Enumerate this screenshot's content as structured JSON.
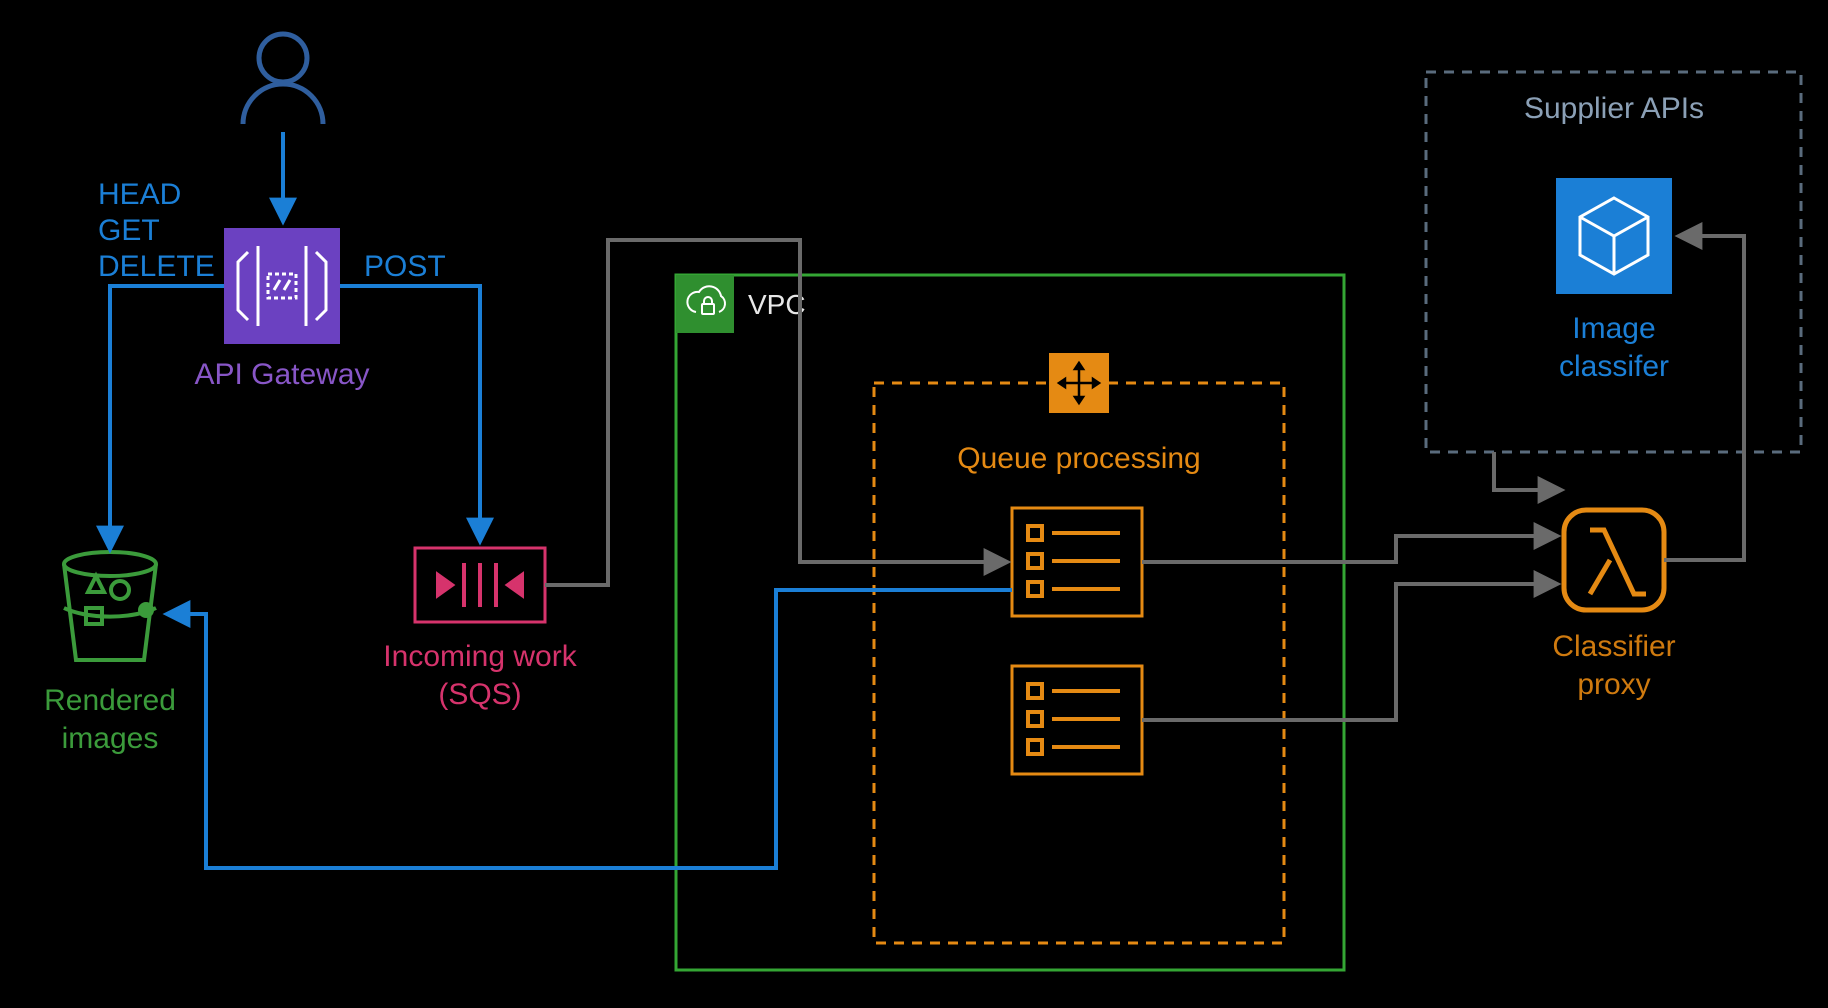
{
  "nodes": {
    "user": {
      "name": "user-icon"
    },
    "api_gateway": {
      "label": "API Gateway"
    },
    "s3": {
      "label_line1": "Rendered",
      "label_line2": "images"
    },
    "sqs": {
      "label_line1": "Incoming work",
      "label_line2": "(SQS)"
    },
    "vpc": {
      "label": "VPC"
    },
    "autoscale": {
      "label": "Queue processing"
    },
    "lambda": {
      "label_line1": "Classifier",
      "label_line2": "proxy"
    },
    "supplier_group": {
      "label": "Supplier APIs"
    },
    "image_classifier": {
      "label_line1": "Image",
      "label_line2": "classifer"
    }
  },
  "edges": {
    "api_gateway_left": {
      "line1": "HEAD",
      "line2": "GET",
      "line3": "DELETE"
    },
    "api_gateway_right": {
      "label": "POST"
    }
  },
  "colors": {
    "user": "#2f5e9e",
    "blue_arrow": "#1b7fd6",
    "api_purple": "#8856c7",
    "api_fill": "#6b41c1",
    "s3_green": "#3b9b3b",
    "sqs_pink": "#d6336c",
    "vpc_green": "#34a634",
    "vpc_badge": "#2f8f2f",
    "orange": "#e58a13",
    "lambda": "#e58a13",
    "supplier_slate": "#5a6b7d",
    "supplier_text": "#8ba0b6",
    "classifier_blue": "#1b7fd6",
    "grey": "#5e5e5e",
    "white": "#e8e8e8"
  }
}
